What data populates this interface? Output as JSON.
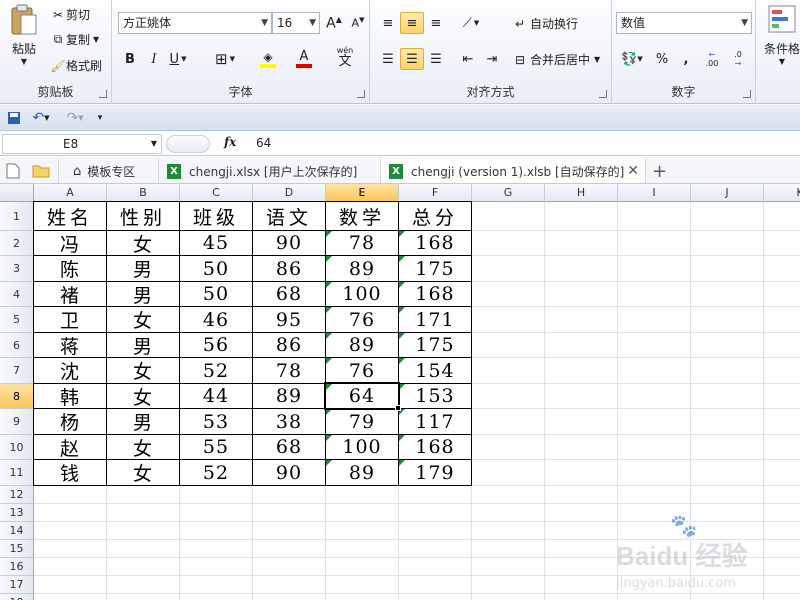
{
  "ribbon": {
    "clipboard": {
      "paste_label": "粘贴",
      "cut_label": "剪切",
      "copy_label": "复制",
      "format_painter_label": "格式刷",
      "group_label": "剪贴板"
    },
    "font": {
      "font_name": "方正姚体",
      "font_size": "16",
      "bold": "B",
      "italic": "I",
      "underline": "U",
      "phonetic": "wén",
      "group_label": "字体"
    },
    "alignment": {
      "wrap_text_label": "自动换行",
      "merge_center_label": "合并后居中",
      "group_label": "对齐方式"
    },
    "number": {
      "format_value": "数值",
      "percent": "%",
      "comma": ",",
      "inc_decimal": ".00",
      "dec_decimal": ".0",
      "group_label": "数字"
    },
    "styles": {
      "cond_format_label": "条件格"
    }
  },
  "formula_bar": {
    "name_box": "E8",
    "fx": "fx",
    "content": "64"
  },
  "tabs": [
    {
      "label": "模板专区"
    },
    {
      "label": "chengji.xlsx [用户上次保存的]"
    },
    {
      "label": "chengji (version 1).xlsb [自动保存的]"
    }
  ],
  "columns": [
    "A",
    "B",
    "C",
    "D",
    "E",
    "F",
    "G",
    "H",
    "I",
    "J",
    "K"
  ],
  "rows": [
    "1",
    "2",
    "3",
    "4",
    "5",
    "6",
    "7",
    "8",
    "9",
    "10",
    "11",
    "12",
    "13",
    "14",
    "15",
    "16",
    "17",
    "18"
  ],
  "table": {
    "headers": [
      "姓名",
      "性别",
      "班级",
      "语文",
      "数学",
      "总分"
    ],
    "data": [
      [
        "冯",
        "女",
        "45",
        "90",
        "78",
        "168"
      ],
      [
        "陈",
        "男",
        "50",
        "86",
        "89",
        "175"
      ],
      [
        "褚",
        "男",
        "50",
        "68",
        "100",
        "168"
      ],
      [
        "卫",
        "女",
        "46",
        "95",
        "76",
        "171"
      ],
      [
        "蒋",
        "男",
        "56",
        "86",
        "89",
        "175"
      ],
      [
        "沈",
        "女",
        "52",
        "78",
        "76",
        "154"
      ],
      [
        "韩",
        "女",
        "44",
        "89",
        "64",
        "153"
      ],
      [
        "杨",
        "男",
        "53",
        "38",
        "79",
        "117"
      ],
      [
        "赵",
        "女",
        "55",
        "68",
        "100",
        "168"
      ],
      [
        "钱",
        "女",
        "52",
        "90",
        "89",
        "179"
      ]
    ]
  },
  "selection": {
    "cell": "E8",
    "column": "E",
    "row": "8"
  },
  "watermark": {
    "text": "Baidu 经验",
    "url": "jingyan.baidu.com"
  },
  "colors": {
    "accent": "#ffd36e",
    "selected_header": "#f9c65b",
    "excel_green": "#1f8a3a"
  }
}
